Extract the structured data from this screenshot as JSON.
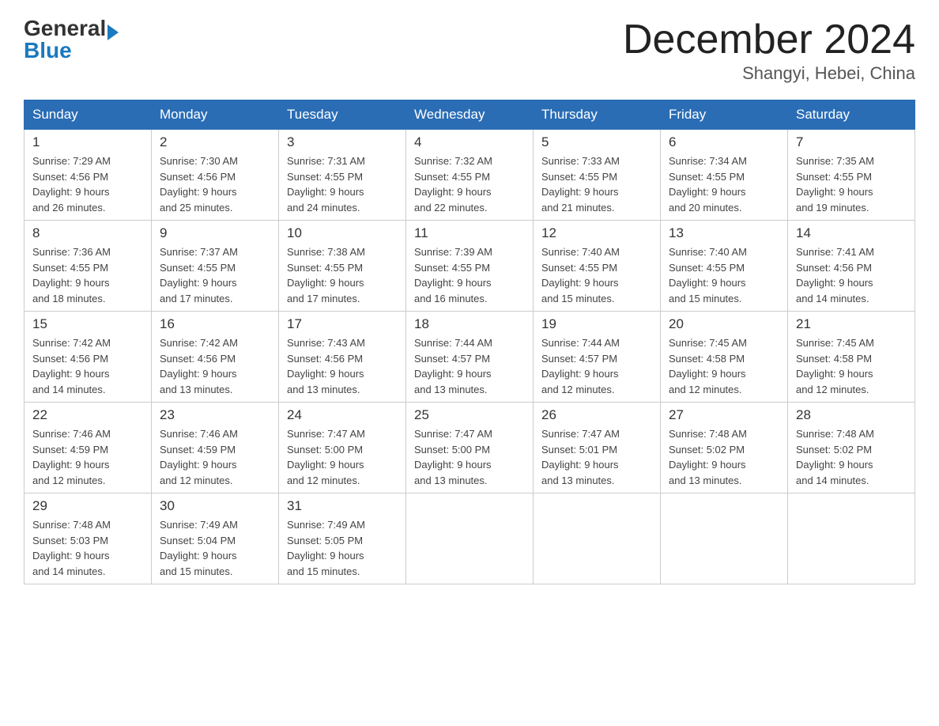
{
  "header": {
    "logo": {
      "general": "General",
      "blue": "Blue"
    },
    "title": "December 2024",
    "location": "Shangyi, Hebei, China"
  },
  "weekdays": [
    "Sunday",
    "Monday",
    "Tuesday",
    "Wednesday",
    "Thursday",
    "Friday",
    "Saturday"
  ],
  "weeks": [
    [
      {
        "day": "1",
        "sunrise": "7:29 AM",
        "sunset": "4:56 PM",
        "daylight": "9 hours and 26 minutes."
      },
      {
        "day": "2",
        "sunrise": "7:30 AM",
        "sunset": "4:56 PM",
        "daylight": "9 hours and 25 minutes."
      },
      {
        "day": "3",
        "sunrise": "7:31 AM",
        "sunset": "4:55 PM",
        "daylight": "9 hours and 24 minutes."
      },
      {
        "day": "4",
        "sunrise": "7:32 AM",
        "sunset": "4:55 PM",
        "daylight": "9 hours and 22 minutes."
      },
      {
        "day": "5",
        "sunrise": "7:33 AM",
        "sunset": "4:55 PM",
        "daylight": "9 hours and 21 minutes."
      },
      {
        "day": "6",
        "sunrise": "7:34 AM",
        "sunset": "4:55 PM",
        "daylight": "9 hours and 20 minutes."
      },
      {
        "day": "7",
        "sunrise": "7:35 AM",
        "sunset": "4:55 PM",
        "daylight": "9 hours and 19 minutes."
      }
    ],
    [
      {
        "day": "8",
        "sunrise": "7:36 AM",
        "sunset": "4:55 PM",
        "daylight": "9 hours and 18 minutes."
      },
      {
        "day": "9",
        "sunrise": "7:37 AM",
        "sunset": "4:55 PM",
        "daylight": "9 hours and 17 minutes."
      },
      {
        "day": "10",
        "sunrise": "7:38 AM",
        "sunset": "4:55 PM",
        "daylight": "9 hours and 17 minutes."
      },
      {
        "day": "11",
        "sunrise": "7:39 AM",
        "sunset": "4:55 PM",
        "daylight": "9 hours and 16 minutes."
      },
      {
        "day": "12",
        "sunrise": "7:40 AM",
        "sunset": "4:55 PM",
        "daylight": "9 hours and 15 minutes."
      },
      {
        "day": "13",
        "sunrise": "7:40 AM",
        "sunset": "4:55 PM",
        "daylight": "9 hours and 15 minutes."
      },
      {
        "day": "14",
        "sunrise": "7:41 AM",
        "sunset": "4:56 PM",
        "daylight": "9 hours and 14 minutes."
      }
    ],
    [
      {
        "day": "15",
        "sunrise": "7:42 AM",
        "sunset": "4:56 PM",
        "daylight": "9 hours and 14 minutes."
      },
      {
        "day": "16",
        "sunrise": "7:42 AM",
        "sunset": "4:56 PM",
        "daylight": "9 hours and 13 minutes."
      },
      {
        "day": "17",
        "sunrise": "7:43 AM",
        "sunset": "4:56 PM",
        "daylight": "9 hours and 13 minutes."
      },
      {
        "day": "18",
        "sunrise": "7:44 AM",
        "sunset": "4:57 PM",
        "daylight": "9 hours and 13 minutes."
      },
      {
        "day": "19",
        "sunrise": "7:44 AM",
        "sunset": "4:57 PM",
        "daylight": "9 hours and 12 minutes."
      },
      {
        "day": "20",
        "sunrise": "7:45 AM",
        "sunset": "4:58 PM",
        "daylight": "9 hours and 12 minutes."
      },
      {
        "day": "21",
        "sunrise": "7:45 AM",
        "sunset": "4:58 PM",
        "daylight": "9 hours and 12 minutes."
      }
    ],
    [
      {
        "day": "22",
        "sunrise": "7:46 AM",
        "sunset": "4:59 PM",
        "daylight": "9 hours and 12 minutes."
      },
      {
        "day": "23",
        "sunrise": "7:46 AM",
        "sunset": "4:59 PM",
        "daylight": "9 hours and 12 minutes."
      },
      {
        "day": "24",
        "sunrise": "7:47 AM",
        "sunset": "5:00 PM",
        "daylight": "9 hours and 12 minutes."
      },
      {
        "day": "25",
        "sunrise": "7:47 AM",
        "sunset": "5:00 PM",
        "daylight": "9 hours and 13 minutes."
      },
      {
        "day": "26",
        "sunrise": "7:47 AM",
        "sunset": "5:01 PM",
        "daylight": "9 hours and 13 minutes."
      },
      {
        "day": "27",
        "sunrise": "7:48 AM",
        "sunset": "5:02 PM",
        "daylight": "9 hours and 13 minutes."
      },
      {
        "day": "28",
        "sunrise": "7:48 AM",
        "sunset": "5:02 PM",
        "daylight": "9 hours and 14 minutes."
      }
    ],
    [
      {
        "day": "29",
        "sunrise": "7:48 AM",
        "sunset": "5:03 PM",
        "daylight": "9 hours and 14 minutes."
      },
      {
        "day": "30",
        "sunrise": "7:49 AM",
        "sunset": "5:04 PM",
        "daylight": "9 hours and 15 minutes."
      },
      {
        "day": "31",
        "sunrise": "7:49 AM",
        "sunset": "5:05 PM",
        "daylight": "9 hours and 15 minutes."
      },
      null,
      null,
      null,
      null
    ]
  ],
  "labels": {
    "sunrise": "Sunrise:",
    "sunset": "Sunset:",
    "daylight": "Daylight:"
  }
}
